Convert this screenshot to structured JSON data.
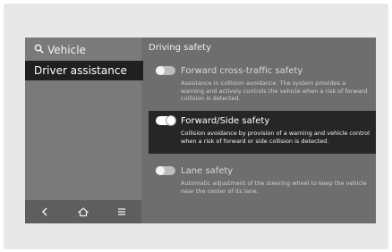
{
  "sidebar": {
    "crumb_icon": "search-icon",
    "crumb_label": "Vehicle",
    "selected_item": "Driver assistance",
    "nav_icons": [
      "back-icon",
      "home-icon",
      "menu-icon"
    ]
  },
  "main": {
    "section_title": "Driving safety",
    "options": [
      {
        "title": "Forward cross-traffic safety",
        "description": "Assistance in collision avoidance. The system provides a warning and actively controls the vehicle when a risk of forward collision is detected.",
        "enabled": false,
        "selected": false
      },
      {
        "title": "Forward/Side safety",
        "description": "Collision avoidance by provision of a warning and vehicle control when a risk of forward or side collision is detected.",
        "enabled": true,
        "selected": true
      },
      {
        "title": "Lane safety",
        "description": "Automatic adjustment of the steering wheel to keep the vehicle near the center of its lane.",
        "enabled": false,
        "selected": false
      }
    ]
  }
}
